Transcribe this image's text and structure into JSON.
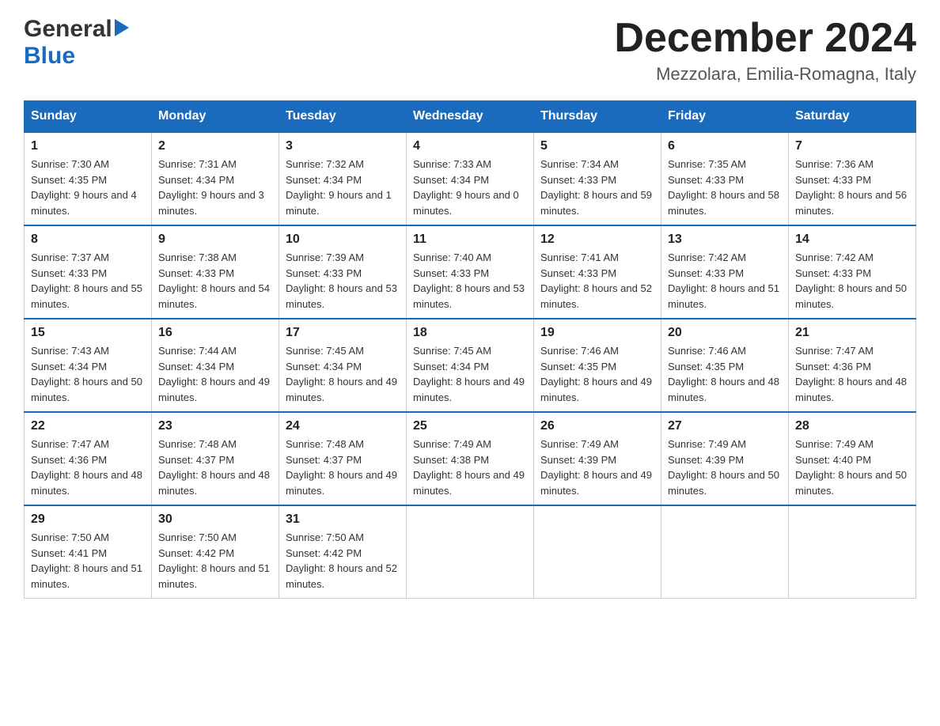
{
  "logo": {
    "general": "General",
    "blue": "Blue"
  },
  "title": "December 2024",
  "location": "Mezzolara, Emilia-Romagna, Italy",
  "days_of_week": [
    "Sunday",
    "Monday",
    "Tuesday",
    "Wednesday",
    "Thursday",
    "Friday",
    "Saturday"
  ],
  "weeks": [
    [
      {
        "day": "1",
        "sunrise": "7:30 AM",
        "sunset": "4:35 PM",
        "daylight": "9 hours and 4 minutes."
      },
      {
        "day": "2",
        "sunrise": "7:31 AM",
        "sunset": "4:34 PM",
        "daylight": "9 hours and 3 minutes."
      },
      {
        "day": "3",
        "sunrise": "7:32 AM",
        "sunset": "4:34 PM",
        "daylight": "9 hours and 1 minute."
      },
      {
        "day": "4",
        "sunrise": "7:33 AM",
        "sunset": "4:34 PM",
        "daylight": "9 hours and 0 minutes."
      },
      {
        "day": "5",
        "sunrise": "7:34 AM",
        "sunset": "4:33 PM",
        "daylight": "8 hours and 59 minutes."
      },
      {
        "day": "6",
        "sunrise": "7:35 AM",
        "sunset": "4:33 PM",
        "daylight": "8 hours and 58 minutes."
      },
      {
        "day": "7",
        "sunrise": "7:36 AM",
        "sunset": "4:33 PM",
        "daylight": "8 hours and 56 minutes."
      }
    ],
    [
      {
        "day": "8",
        "sunrise": "7:37 AM",
        "sunset": "4:33 PM",
        "daylight": "8 hours and 55 minutes."
      },
      {
        "day": "9",
        "sunrise": "7:38 AM",
        "sunset": "4:33 PM",
        "daylight": "8 hours and 54 minutes."
      },
      {
        "day": "10",
        "sunrise": "7:39 AM",
        "sunset": "4:33 PM",
        "daylight": "8 hours and 53 minutes."
      },
      {
        "day": "11",
        "sunrise": "7:40 AM",
        "sunset": "4:33 PM",
        "daylight": "8 hours and 53 minutes."
      },
      {
        "day": "12",
        "sunrise": "7:41 AM",
        "sunset": "4:33 PM",
        "daylight": "8 hours and 52 minutes."
      },
      {
        "day": "13",
        "sunrise": "7:42 AM",
        "sunset": "4:33 PM",
        "daylight": "8 hours and 51 minutes."
      },
      {
        "day": "14",
        "sunrise": "7:42 AM",
        "sunset": "4:33 PM",
        "daylight": "8 hours and 50 minutes."
      }
    ],
    [
      {
        "day": "15",
        "sunrise": "7:43 AM",
        "sunset": "4:34 PM",
        "daylight": "8 hours and 50 minutes."
      },
      {
        "day": "16",
        "sunrise": "7:44 AM",
        "sunset": "4:34 PM",
        "daylight": "8 hours and 49 minutes."
      },
      {
        "day": "17",
        "sunrise": "7:45 AM",
        "sunset": "4:34 PM",
        "daylight": "8 hours and 49 minutes."
      },
      {
        "day": "18",
        "sunrise": "7:45 AM",
        "sunset": "4:34 PM",
        "daylight": "8 hours and 49 minutes."
      },
      {
        "day": "19",
        "sunrise": "7:46 AM",
        "sunset": "4:35 PM",
        "daylight": "8 hours and 49 minutes."
      },
      {
        "day": "20",
        "sunrise": "7:46 AM",
        "sunset": "4:35 PM",
        "daylight": "8 hours and 48 minutes."
      },
      {
        "day": "21",
        "sunrise": "7:47 AM",
        "sunset": "4:36 PM",
        "daylight": "8 hours and 48 minutes."
      }
    ],
    [
      {
        "day": "22",
        "sunrise": "7:47 AM",
        "sunset": "4:36 PM",
        "daylight": "8 hours and 48 minutes."
      },
      {
        "day": "23",
        "sunrise": "7:48 AM",
        "sunset": "4:37 PM",
        "daylight": "8 hours and 48 minutes."
      },
      {
        "day": "24",
        "sunrise": "7:48 AM",
        "sunset": "4:37 PM",
        "daylight": "8 hours and 49 minutes."
      },
      {
        "day": "25",
        "sunrise": "7:49 AM",
        "sunset": "4:38 PM",
        "daylight": "8 hours and 49 minutes."
      },
      {
        "day": "26",
        "sunrise": "7:49 AM",
        "sunset": "4:39 PM",
        "daylight": "8 hours and 49 minutes."
      },
      {
        "day": "27",
        "sunrise": "7:49 AM",
        "sunset": "4:39 PM",
        "daylight": "8 hours and 50 minutes."
      },
      {
        "day": "28",
        "sunrise": "7:49 AM",
        "sunset": "4:40 PM",
        "daylight": "8 hours and 50 minutes."
      }
    ],
    [
      {
        "day": "29",
        "sunrise": "7:50 AM",
        "sunset": "4:41 PM",
        "daylight": "8 hours and 51 minutes."
      },
      {
        "day": "30",
        "sunrise": "7:50 AM",
        "sunset": "4:42 PM",
        "daylight": "8 hours and 51 minutes."
      },
      {
        "day": "31",
        "sunrise": "7:50 AM",
        "sunset": "4:42 PM",
        "daylight": "8 hours and 52 minutes."
      },
      null,
      null,
      null,
      null
    ]
  ],
  "labels": {
    "sunrise": "Sunrise:",
    "sunset": "Sunset:",
    "daylight": "Daylight:"
  }
}
